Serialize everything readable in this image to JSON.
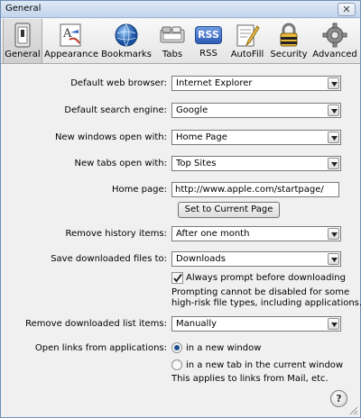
{
  "window": {
    "title": "General",
    "close_label": "✕"
  },
  "toolbar": {
    "items": [
      {
        "label": "General",
        "icon": "general-switch-icon",
        "selected": true
      },
      {
        "label": "Appearance",
        "icon": "appearance-icon"
      },
      {
        "label": "Bookmarks",
        "icon": "bookmarks-globe-icon"
      },
      {
        "label": "Tabs",
        "icon": "tabs-icon"
      },
      {
        "label": "RSS",
        "icon": "rss-badge-icon",
        "badge": "RSS"
      },
      {
        "label": "AutoFill",
        "icon": "autofill-pencil-icon"
      },
      {
        "label": "Security",
        "icon": "security-lock-icon"
      },
      {
        "label": "Advanced",
        "icon": "advanced-gear-icon"
      }
    ]
  },
  "general": {
    "default_browser": {
      "label": "Default web browser:",
      "value": "Internet Explorer"
    },
    "default_search": {
      "label": "Default search engine:",
      "value": "Google"
    },
    "new_windows": {
      "label": "New windows open with:",
      "value": "Home Page"
    },
    "new_tabs": {
      "label": "New tabs open with:",
      "value": "Top Sites"
    },
    "home_page": {
      "label": "Home page:",
      "value": "http://www.apple.com/startpage/"
    },
    "set_current_label": "Set to Current Page",
    "remove_history": {
      "label": "Remove history items:",
      "value": "After one month"
    },
    "save_downloads": {
      "label": "Save downloaded files to:",
      "value": "Downloads"
    },
    "always_prompt": {
      "label": "Always prompt before downloading",
      "checked": true,
      "note_line1": "Prompting cannot be disabled for some",
      "note_line2": "high-risk file types, including applications."
    },
    "remove_download_list": {
      "label": "Remove downloaded list items:",
      "value": "Manually"
    },
    "open_links": {
      "label": "Open links from applications:",
      "option_window": "in a new window",
      "option_tab": "in a new tab in the current window",
      "selected": "in a new window",
      "note": "This applies to links from Mail, etc."
    },
    "help_label": "?"
  },
  "colors": {
    "selection_blue": "#1d4f8f",
    "border": "#7a7a7a"
  }
}
